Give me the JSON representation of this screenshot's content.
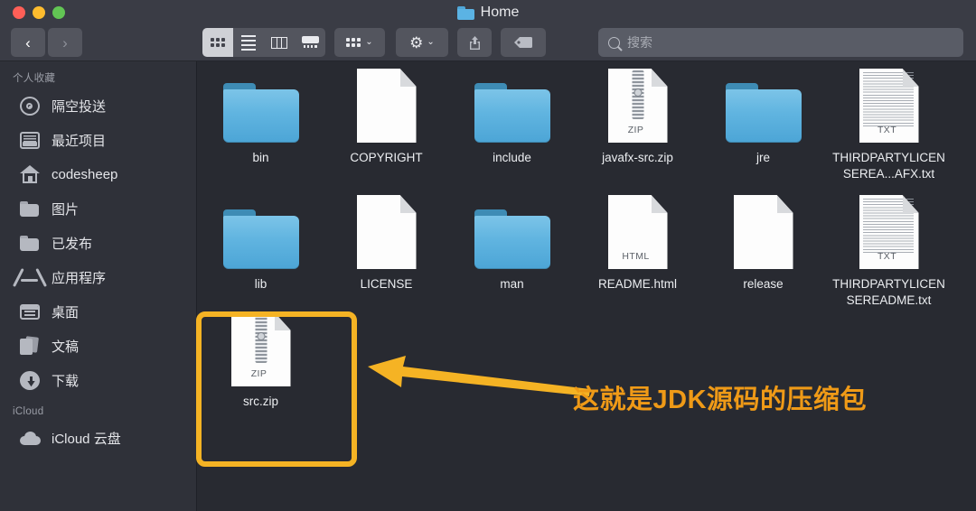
{
  "window": {
    "title": "Home",
    "title_icon": "folder-icon",
    "traffic_lights": [
      {
        "name": "close-button",
        "color": "#ff5f57"
      },
      {
        "name": "minimize-button",
        "color": "#febc2e"
      },
      {
        "name": "maximize-button",
        "color": "#62c554"
      }
    ]
  },
  "toolbar": {
    "back_glyph": "‹",
    "forward_glyph": "›",
    "chevron_glyph": "⌄",
    "view_modes": [
      {
        "name": "icon-view",
        "icon": "grid-icon",
        "active": true
      },
      {
        "name": "list-view",
        "icon": "list-icon",
        "active": false
      },
      {
        "name": "column-view",
        "icon": "columns-icon",
        "active": false
      },
      {
        "name": "gallery-view",
        "icon": "gallery-icon",
        "active": false
      }
    ],
    "group_button": {
      "name": "group-by-button",
      "icon": "grid-icon"
    },
    "action_button": {
      "name": "action-button",
      "icon": "gear-icon",
      "glyph": "⚙"
    },
    "share_button": {
      "name": "share-button",
      "icon": "share-icon",
      "glyph": "⇧"
    },
    "tag_button": {
      "name": "tag-button",
      "icon": "tag-icon"
    }
  },
  "search": {
    "placeholder": "搜索",
    "value": "",
    "icon": "search-icon"
  },
  "sidebar": {
    "sections": [
      {
        "header": "个人收藏",
        "items": [
          {
            "label": "隔空投送",
            "icon": "airdrop-icon",
            "icon_class": "ico-airdrop"
          },
          {
            "label": "最近项目",
            "icon": "recents-icon",
            "icon_class": "ico-recent"
          },
          {
            "label": "codesheep",
            "icon": "home-icon",
            "icon_class": "ico-home"
          },
          {
            "label": "图片",
            "icon": "folder-icon",
            "icon_class": "ico-folder"
          },
          {
            "label": "已发布",
            "icon": "folder-icon",
            "icon_class": "ico-folder"
          },
          {
            "label": "应用程序",
            "icon": "applications-icon",
            "icon_class": "ico-apps"
          },
          {
            "label": "桌面",
            "icon": "desktop-icon",
            "icon_class": "ico-desktop"
          },
          {
            "label": "文稿",
            "icon": "documents-icon",
            "icon_class": "ico-docs"
          },
          {
            "label": "下载",
            "icon": "downloads-icon",
            "icon_class": "ico-download"
          }
        ]
      },
      {
        "header": "iCloud",
        "items": [
          {
            "label": "iCloud 云盘",
            "icon": "cloud-icon",
            "icon_class": "ico-cloud"
          }
        ]
      }
    ]
  },
  "files": {
    "rows": [
      [
        {
          "name": "bin",
          "kind": "folder"
        },
        {
          "name": "COPYRIGHT",
          "kind": "document",
          "tag": ""
        },
        {
          "name": "include",
          "kind": "folder"
        },
        {
          "name": "javafx-src.zip",
          "kind": "zip",
          "tag": "ZIP"
        },
        {
          "name": "jre",
          "kind": "folder"
        },
        {
          "name": "THIRDPARTYLICENSEREA...AFX.txt",
          "kind": "text",
          "tag": "TXT"
        }
      ],
      [
        {
          "name": "lib",
          "kind": "folder"
        },
        {
          "name": "LICENSE",
          "kind": "document",
          "tag": ""
        },
        {
          "name": "man",
          "kind": "folder"
        },
        {
          "name": "README.html",
          "kind": "document",
          "tag": "HTML"
        },
        {
          "name": "release",
          "kind": "document",
          "tag": ""
        },
        {
          "name": "THIRDPARTYLICENSEREADME.txt",
          "kind": "text",
          "tag": "TXT"
        }
      ],
      [
        {
          "name": "src.zip",
          "kind": "zip",
          "tag": "ZIP",
          "highlighted": true
        }
      ]
    ]
  },
  "annotation": {
    "text": "这就是JDK源码的压缩包",
    "color": "#ef9a17",
    "box_color": "#f5b324",
    "arrow": "left-arrow"
  }
}
